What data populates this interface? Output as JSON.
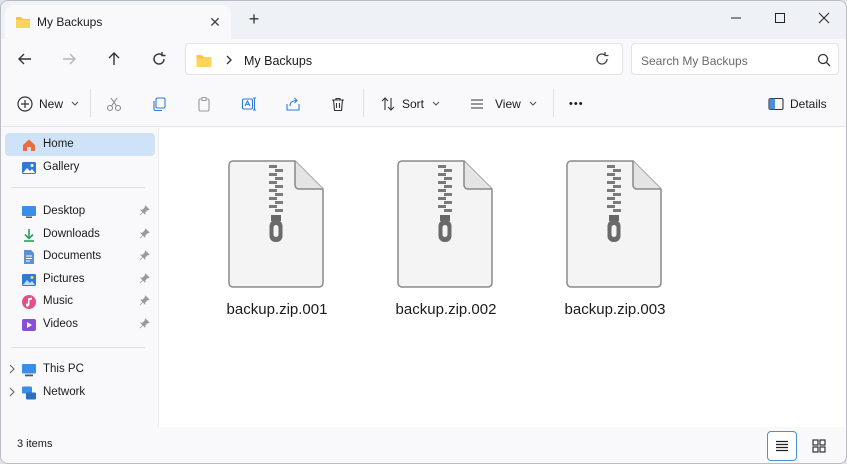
{
  "window": {
    "tab_title": "My Backups",
    "new_tab": "+"
  },
  "nav": {
    "breadcrumb": "My Backups",
    "search_placeholder": "Search My Backups"
  },
  "commands": {
    "new_label": "New",
    "sort_label": "Sort",
    "view_label": "View",
    "more_label": "•••",
    "details_label": "Details"
  },
  "sidebar": {
    "items": [
      {
        "label": "Home",
        "icon": "home-icon"
      },
      {
        "label": "Gallery",
        "icon": "gallery-icon"
      },
      {
        "label": "Desktop",
        "icon": "desktop-icon"
      },
      {
        "label": "Downloads",
        "icon": "downloads-icon"
      },
      {
        "label": "Documents",
        "icon": "documents-icon"
      },
      {
        "label": "Pictures",
        "icon": "pictures-icon"
      },
      {
        "label": "Music",
        "icon": "music-icon"
      },
      {
        "label": "Videos",
        "icon": "videos-icon"
      },
      {
        "label": "This PC",
        "icon": "pc-icon"
      },
      {
        "label": "Network",
        "icon": "network-icon"
      }
    ]
  },
  "files": [
    {
      "name": "backup.zip.001",
      "icon": "zip-file-icon"
    },
    {
      "name": "backup.zip.002",
      "icon": "zip-file-icon"
    },
    {
      "name": "backup.zip.003",
      "icon": "zip-file-icon"
    }
  ],
  "status": {
    "item_count": "3 items"
  },
  "colors": {
    "accent": "#0067c0",
    "selected_bg": "#cfe3f8",
    "folder_yellow": "#f8c63c"
  }
}
